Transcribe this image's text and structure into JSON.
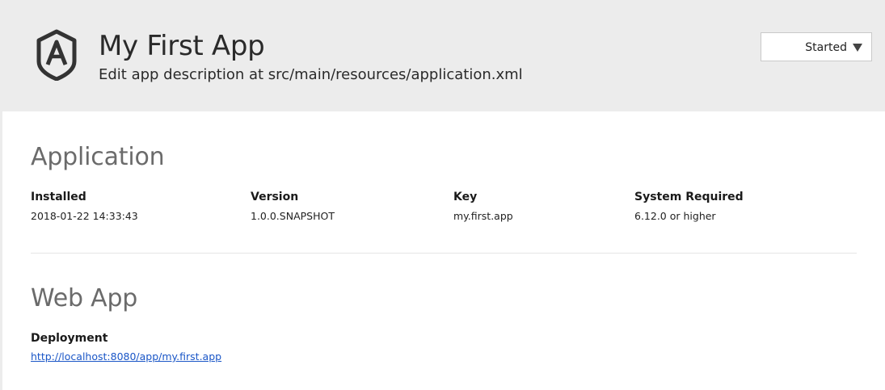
{
  "header": {
    "title": "My First App",
    "description": "Edit app description at src/main/resources/application.xml",
    "logo_icon": "shield-a-logo-icon",
    "status_select": {
      "value": "Started",
      "caret_icon": "triangle-down-icon"
    }
  },
  "application": {
    "title": "Application",
    "fields": [
      {
        "label": "Installed",
        "value": "2018-01-22 14:33:43"
      },
      {
        "label": "Version",
        "value": "1.0.0.SNAPSHOT"
      },
      {
        "label": "Key",
        "value": "my.first.app"
      },
      {
        "label": "System Required",
        "value": "6.12.0 or higher"
      }
    ]
  },
  "web_app": {
    "title": "Web App",
    "deployment_label": "Deployment",
    "deployment_url": "http://localhost:8080/app/my.first.app"
  },
  "colors": {
    "header_bg": "#ececec",
    "section_title": "#6b6b6b",
    "link": "#1a56c7"
  }
}
